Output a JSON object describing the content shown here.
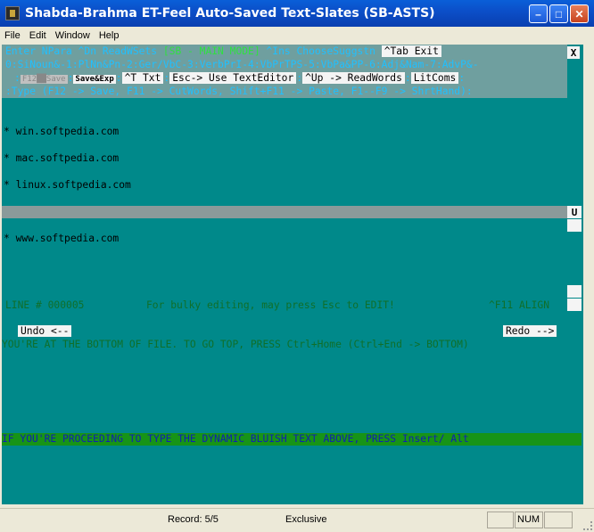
{
  "window": {
    "title": "Shabda-Brahma ET-Feel Auto-Saved Text-Slates (SB-ASTS)"
  },
  "menu": [
    "File",
    "Edit",
    "Window",
    "Help"
  ],
  "ruler": {
    "line1_a": " Enter NPara  ^Dn ReadWSets  ",
    "mode": "[SB - MAIN MODE]",
    "line1_b": "  ^Ins ChooseSuggstn ",
    "tab_exit": "^Tab Exit",
    "close": "X",
    "line2": " 0:SiNoun&-1:PlNn&Pn-2:Ger/VbC-3:VerbPrI-4:VbPrTPS-5:VbPa&PP-6:Adj&Nam-7:AdvP&-",
    "f12": "F12",
    "save": "Save",
    "save_exp": "Save&Exp",
    "t_txt": "^T Txt",
    "esc_editor": "Esc-> Use TextEditor",
    "up_read": "^Up -> ReadWords",
    "litcoms": "LitComs",
    "line4": "  :Type (F12 -> Save, F11 -> CutWords, Shift+F11 -> Paste, F1--F9 -> ShrtHand):"
  },
  "lines": [
    "* win.softpedia.com",
    "* mac.softpedia.com",
    "* linux.softpedia.com",
    "* www.softpedia.com"
  ],
  "scroll_u": "U",
  "line_status": {
    "line_no": "  LINE # 000005",
    "hint": "For bulky editing, may press Esc to EDIT!",
    "align": "^F11 ALIGN"
  },
  "undo": "Undo <--",
  "redo": "Redo -->",
  "bottom_msg": "  YOU'RE AT THE BOTTOM OF FILE. TO GO TOP, PRESS Ctrl+Home (Ctrl+End -> BOTTOM)",
  "dynamic_msg": "  IF YOU'RE PROCEEDING TO TYPE THE DYNAMIC BLUISH TEXT ABOVE, PRESS Insert/ Alt",
  "statusbar": {
    "record": "Record: 5/5",
    "mode": "Exclusive",
    "num": "NUM"
  }
}
